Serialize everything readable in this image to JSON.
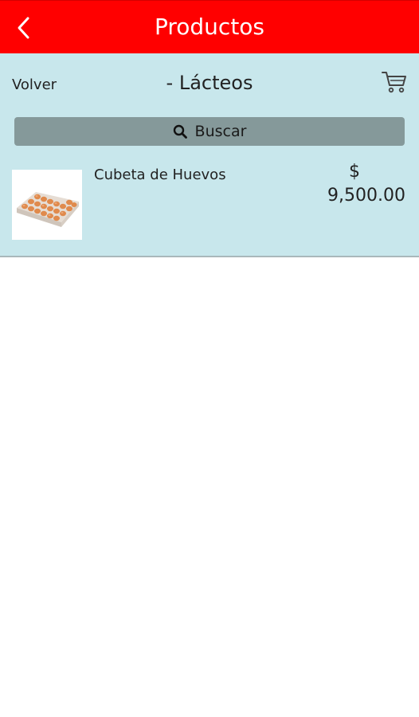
{
  "header": {
    "title": "Productos"
  },
  "nav": {
    "back_label": "Volver",
    "category": "- Lácteos"
  },
  "search": {
    "label": "Buscar"
  },
  "products": [
    {
      "name": "Cubeta de Huevos",
      "currency": "$",
      "price": "9,500.00"
    }
  ],
  "icons": {
    "back": "chevron-left-icon",
    "cart": "cart-icon",
    "search": "search-icon"
  },
  "colors": {
    "header_bg": "#ff0000",
    "panel_bg": "#c8e7ec",
    "search_bg": "#85999a"
  }
}
